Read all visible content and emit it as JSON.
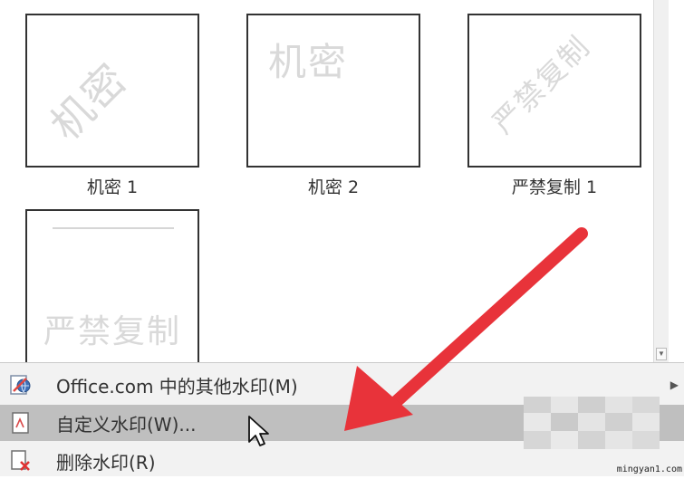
{
  "watermarks": [
    {
      "label": "机密 1",
      "text": "机密"
    },
    {
      "label": "机密 2",
      "text": "机密"
    },
    {
      "label": "严禁复制 1",
      "text": "严禁复制"
    },
    {
      "label": "",
      "text": "严禁复制"
    }
  ],
  "menu": {
    "items": [
      {
        "label": "Office.com 中的其他水印(M)",
        "icon": "office-globe-icon"
      },
      {
        "label": "自定义水印(W)...",
        "icon": "custom-watermark-icon"
      },
      {
        "label": "删除水印(R)",
        "icon": "remove-watermark-icon"
      }
    ]
  },
  "site": "mingyan1.com",
  "colors": {
    "arrow": "#e8333a",
    "highlight": "#bfbfbf",
    "menu_bg": "#f2f2f2"
  }
}
